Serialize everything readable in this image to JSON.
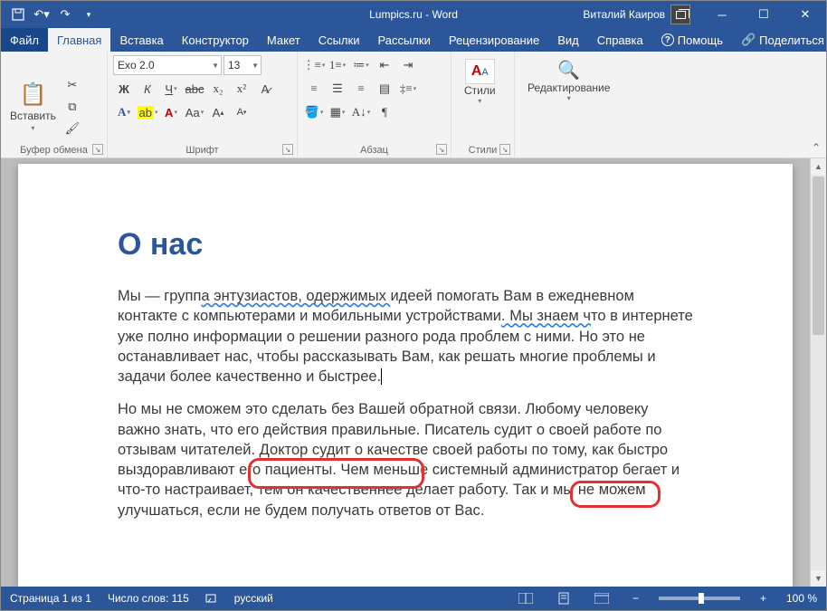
{
  "titlebar": {
    "title": "Lumpics.ru - Word",
    "user": "Виталий Каиров"
  },
  "menu": {
    "file": "Файл",
    "tabs": [
      "Главная",
      "Вставка",
      "Конструктор",
      "Макет",
      "Ссылки",
      "Рассылки",
      "Рецензирование",
      "Вид",
      "Справка"
    ],
    "help_btn": "Помощь",
    "share_btn": "Поделиться"
  },
  "ribbon": {
    "clipboard": {
      "label": "Буфер обмена",
      "paste": "Вставить"
    },
    "font": {
      "label": "Шрифт",
      "name": "Exo 2.0",
      "size": "13"
    },
    "para": {
      "label": "Абзац"
    },
    "styles": {
      "label": "Стили",
      "btn": "Стили"
    },
    "editing": {
      "label": "Редактирование"
    }
  },
  "doc": {
    "heading": "О нас",
    "p1": {
      "t1": "Мы — групп",
      "t2": "а энтузиастов,  одержимых ",
      "t3": "идеей помогать Вам в ежедневном контакте с компьютерами и мобильными устройствами",
      "t4": ". Мы знаем ч",
      "t5": "то в интернете уже полно информации о решении разного рода проблем с ними. Но это не останавливает нас, чтобы рассказывать Вам, как решать многие проблемы и задачи более качественно и быстрее."
    },
    "p2": "Но мы не сможем это сделать без Вашей обратной связи. Любому человеку важно знать, что его действия правильные. Писатель судит о своей работе по отзывам читателей. Доктор судит о качестве своей работы по тому, как быстро выздоравливают его пациенты. Чем меньше системный администратор бегает и что-то настраивает, тем он качественнее делает работу. Так и мы не можем улучшаться, если не будем получать ответов от Вас."
  },
  "status": {
    "page": "Страница 1 из 1",
    "words": "Число слов: 115",
    "lang": "русский",
    "zoom": "100 %"
  }
}
